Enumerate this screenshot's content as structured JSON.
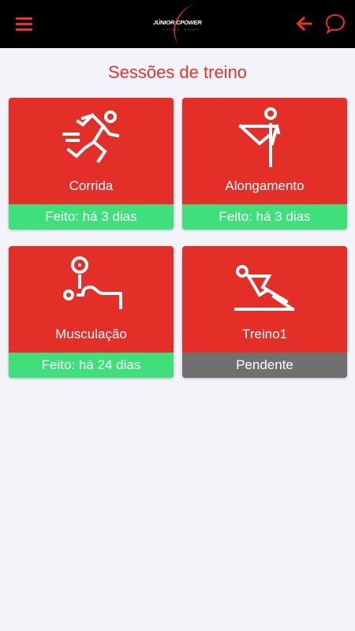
{
  "header": {
    "logo_text": "JÚNIOR CPOWER",
    "logo_subtext": "FITNESS · STUDIO",
    "icons": {
      "menu": "hamburger-menu-icon",
      "back": "arrow-left-icon",
      "chat": "chat-bubble-icon"
    },
    "accent_color": "#e8322b"
  },
  "main": {
    "title": "Sessões de treino",
    "sessions": [
      {
        "name": "Corrida",
        "status": "Feito: há 3 dias",
        "state": "done",
        "icon": "running-person-icon"
      },
      {
        "name": "Alongamento",
        "status": "Feito: há 3 dias",
        "state": "done",
        "icon": "stretching-person-icon"
      },
      {
        "name": "Musculação",
        "status": "Feito: há 24 dias",
        "state": "done",
        "icon": "weightlifting-person-icon"
      },
      {
        "name": "Treino1",
        "status": "Pendente",
        "state": "pending",
        "icon": "situp-person-icon"
      }
    ]
  },
  "colors": {
    "card": "#e42e28",
    "done": "#3fe07c",
    "pending": "#707070",
    "background": "#f3f4f9"
  }
}
